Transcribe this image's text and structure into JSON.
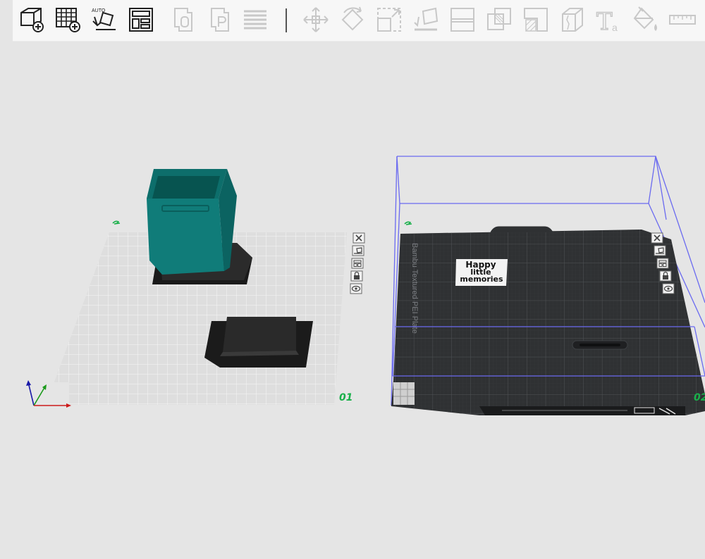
{
  "toolbar": {
    "tools": [
      {
        "name": "add-object",
        "icon": "cube-plus-icon",
        "enabled": true
      },
      {
        "name": "add-plate",
        "icon": "grid-plus-icon",
        "enabled": true
      },
      {
        "name": "auto-orient",
        "icon": "auto-orient-icon",
        "enabled": true,
        "badge": "AUTO"
      },
      {
        "name": "arrange",
        "icon": "arrange-layout-icon",
        "enabled": true
      },
      {
        "name": "split-to-objects",
        "icon": "split-objects-icon",
        "enabled": false
      },
      {
        "name": "split-to-parts",
        "icon": "split-parts-icon",
        "enabled": false
      },
      {
        "name": "layers",
        "icon": "layers-icon",
        "enabled": false
      },
      {
        "name": "move",
        "icon": "move-arrows-icon",
        "enabled": false
      },
      {
        "name": "rotate",
        "icon": "rotate-icon",
        "enabled": false
      },
      {
        "name": "scale",
        "icon": "scale-icon",
        "enabled": false
      },
      {
        "name": "lay-on-face",
        "icon": "lay-on-face-icon",
        "enabled": false
      },
      {
        "name": "cut",
        "icon": "cut-icon",
        "enabled": false
      },
      {
        "name": "boolean",
        "icon": "boolean-icon",
        "enabled": false
      },
      {
        "name": "support-paint",
        "icon": "support-paint-icon",
        "enabled": false
      },
      {
        "name": "seam-paint",
        "icon": "seam-paint-icon",
        "enabled": false
      },
      {
        "name": "text",
        "icon": "text-icon",
        "enabled": false,
        "label": "Ta"
      },
      {
        "name": "color-paint",
        "icon": "paint-bucket-icon",
        "enabled": false
      },
      {
        "name": "measure",
        "icon": "ruler-icon",
        "enabled": false
      }
    ]
  },
  "plates": [
    {
      "number": "01",
      "name": "",
      "objects": [
        "teal-container",
        "black-lid"
      ],
      "selected": false
    },
    {
      "number": "02",
      "name": "Bambu Textured PEI Plate",
      "objects": [
        "text-plaque"
      ],
      "selected": true,
      "plate_label": "Bambu Textured PEI Plate",
      "plaque_text": [
        "Happy",
        "little",
        "memories"
      ]
    }
  ],
  "plate_controls": [
    {
      "name": "delete-plate",
      "icon": "close-icon"
    },
    {
      "name": "orient-plate",
      "icon": "orient-icon"
    },
    {
      "name": "arrange-plate",
      "icon": "arrange-icon"
    },
    {
      "name": "lock-plate",
      "icon": "lock-icon"
    },
    {
      "name": "plate-settings",
      "icon": "eye-settings-icon"
    }
  ],
  "colors": {
    "accent_green": "#19b04a",
    "teal_object": "#0f7a77",
    "selection_box": "#6a6af0",
    "plate_light": "#dedede",
    "plate_dark": "#2f3133"
  }
}
